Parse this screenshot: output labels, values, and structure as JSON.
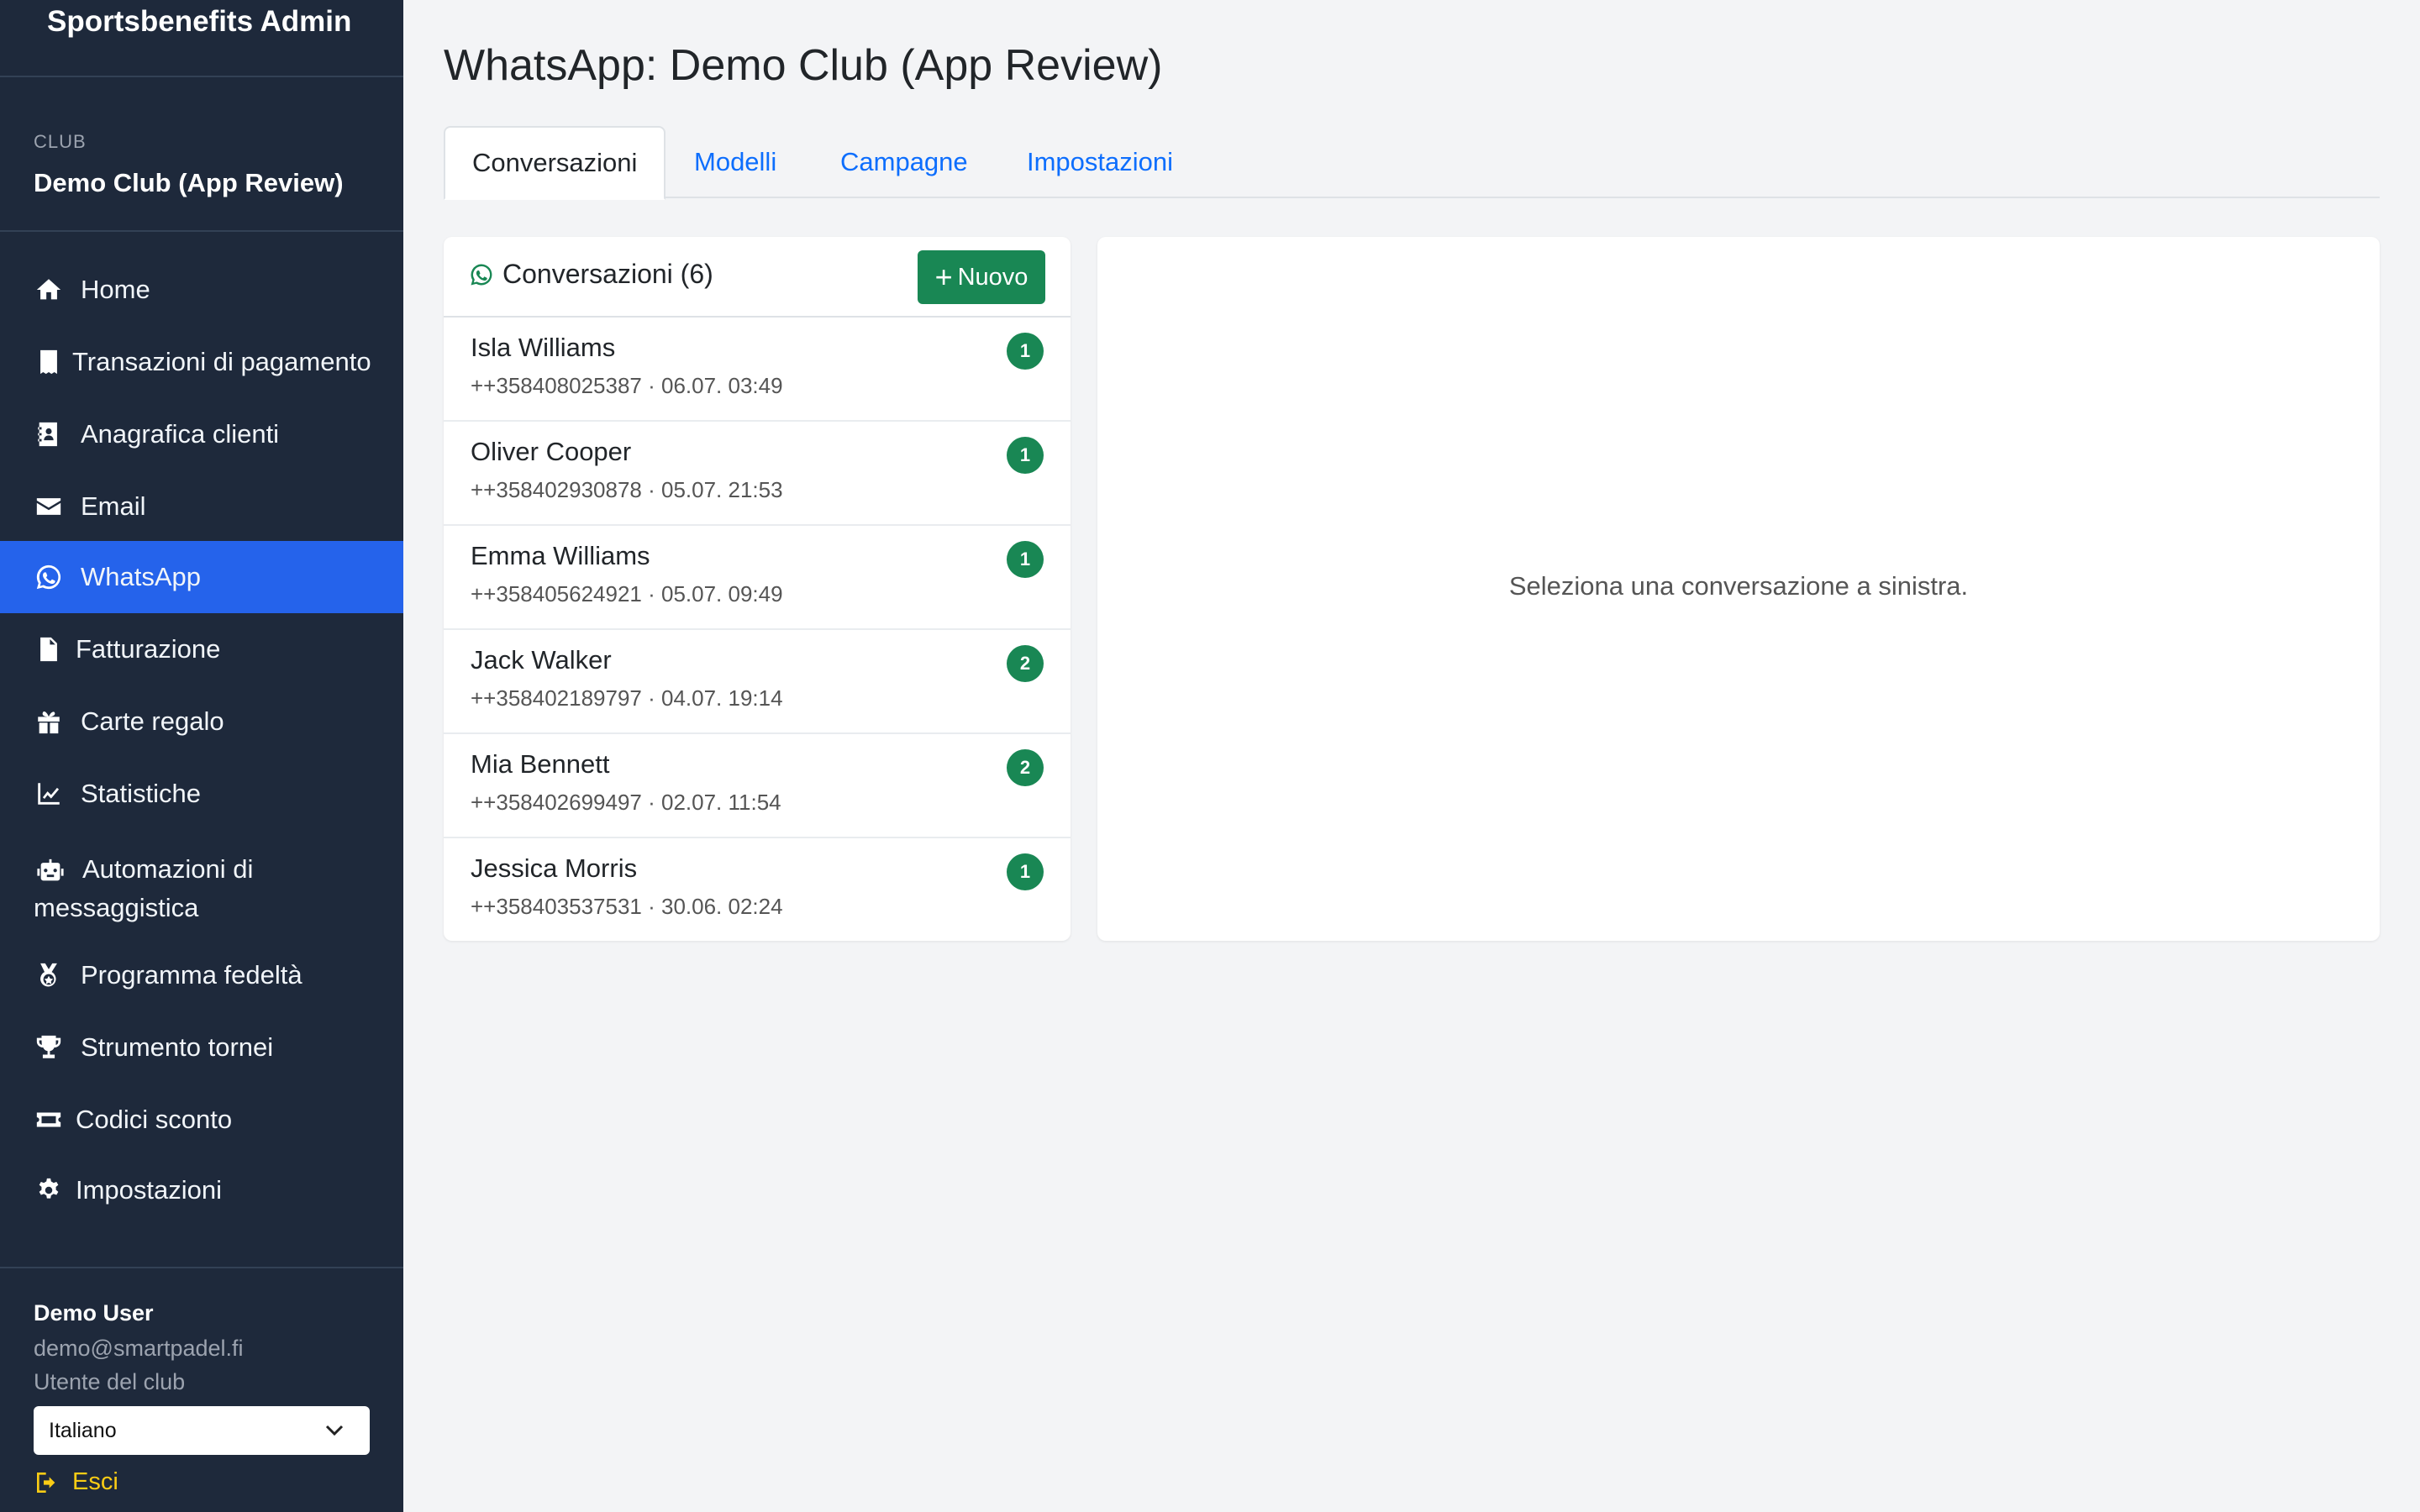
{
  "app": {
    "brand": "Sportsbenefits Admin"
  },
  "club": {
    "label": "CLUB",
    "name": "Demo Club (App Review)"
  },
  "sidebar": {
    "items": [
      {
        "label": "Home",
        "icon": "home-icon"
      },
      {
        "label": "Transazioni di pagamento",
        "icon": "receipt-icon"
      },
      {
        "label": "Anagrafica clienti",
        "icon": "contact-card-icon"
      },
      {
        "label": "Email",
        "icon": "envelope-icon"
      },
      {
        "label": "WhatsApp",
        "icon": "whatsapp-icon",
        "active": true
      },
      {
        "label": "Fatturazione",
        "icon": "invoice-icon"
      },
      {
        "label": "Carte regalo",
        "icon": "gift-icon"
      },
      {
        "label": "Statistiche",
        "icon": "chart-line-icon"
      },
      {
        "label": "Automazioni di messaggistica",
        "icon": "robot-icon"
      },
      {
        "label": "Programma fedeltà",
        "icon": "medal-icon"
      },
      {
        "label": "Strumento tornei",
        "icon": "trophy-icon"
      },
      {
        "label": "Codici sconto",
        "icon": "ticket-icon"
      },
      {
        "label": "Impostazioni",
        "icon": "gear-icon"
      }
    ]
  },
  "user": {
    "name": "Demo User",
    "email": "demo@smartpadel.fi",
    "role": "Utente del club",
    "language": "Italiano",
    "logout": "Esci"
  },
  "page": {
    "title": "WhatsApp: Demo Club (App Review)"
  },
  "tabs": [
    {
      "label": "Conversazioni",
      "active": true
    },
    {
      "label": "Modelli"
    },
    {
      "label": "Campagne"
    },
    {
      "label": "Impostazioni"
    }
  ],
  "conversations": {
    "title": "Conversazioni (6)",
    "new_label": "Nuovo",
    "items": [
      {
        "name": "Isla Williams",
        "meta": "++358408025387 · 06.07. 03:49",
        "unread": "1"
      },
      {
        "name": "Oliver Cooper",
        "meta": "++358402930878 · 05.07. 21:53",
        "unread": "1"
      },
      {
        "name": "Emma Williams",
        "meta": "++358405624921 · 05.07. 09:49",
        "unread": "1"
      },
      {
        "name": "Jack Walker",
        "meta": "++358402189797 · 04.07. 19:14",
        "unread": "2"
      },
      {
        "name": "Mia Bennett",
        "meta": "++358402699497 · 02.07. 11:54",
        "unread": "2"
      },
      {
        "name": "Jessica Morris",
        "meta": "++358403537531 · 30.06. 02:24",
        "unread": "1"
      }
    ]
  },
  "detail": {
    "empty_message": "Seleziona una conversazione a sinistra."
  },
  "colors": {
    "sidebar_bg": "#1e293b",
    "active": "#2563eb",
    "accent_green": "#198754",
    "link": "#0d6efd",
    "logout": "#facc15"
  }
}
